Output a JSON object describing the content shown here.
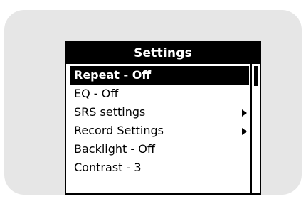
{
  "screen": {
    "title": "Settings"
  },
  "menu": {
    "items": [
      {
        "label": "Repeat - Off",
        "selected": true,
        "has_submenu": false
      },
      {
        "label": "EQ - Off",
        "selected": false,
        "has_submenu": false
      },
      {
        "label": "SRS settings",
        "selected": false,
        "has_submenu": true
      },
      {
        "label": "Record Settings",
        "selected": false,
        "has_submenu": true
      },
      {
        "label": "Backlight - Off",
        "selected": false,
        "has_submenu": false
      },
      {
        "label": "Contrast - 3",
        "selected": false,
        "has_submenu": false
      }
    ]
  },
  "icons": {
    "submenu": "chevron-right-icon"
  },
  "colors": {
    "frame": "#e6e6e6",
    "screen_bg": "#ffffff",
    "highlight": "#000000"
  }
}
